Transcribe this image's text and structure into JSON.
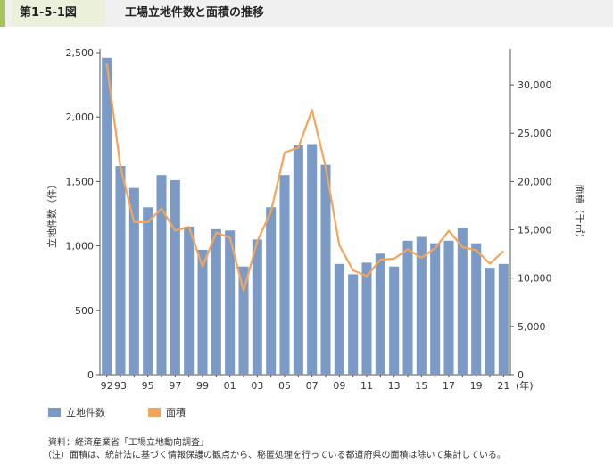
{
  "header": {
    "figure_id": "第1-5-1図",
    "title": "工場立地件数と面積の推移"
  },
  "legend": {
    "bar_label": "立地件数",
    "line_label": "面積"
  },
  "notes": {
    "source": "資料：経済産業省「工場立地動向調査」",
    "note": "（注）面積は、統計法に基づく情報保護の観点から、秘匿処理を行っている都道府県の面積は除いて集計している。"
  },
  "colors": {
    "bar": "#7b9bc6",
    "line": "#f2a55b",
    "accent": "#a6c35a"
  },
  "chart_data": {
    "type": "bar+line",
    "categories": [
      "92",
      "93",
      "94",
      "95",
      "96",
      "97",
      "98",
      "99",
      "00",
      "01",
      "02",
      "03",
      "04",
      "05",
      "06",
      "07",
      "08",
      "09",
      "10",
      "11",
      "12",
      "13",
      "14",
      "15",
      "16",
      "17",
      "18",
      "19",
      "20",
      "21"
    ],
    "x_tick_labels": [
      "92",
      "93",
      "",
      "95",
      "",
      "97",
      "",
      "99",
      "",
      "01",
      "",
      "03",
      "",
      "05",
      "",
      "07",
      "",
      "09",
      "",
      "11",
      "",
      "13",
      "",
      "15",
      "",
      "17",
      "",
      "19",
      "",
      "21"
    ],
    "x_unit": "(年)",
    "series": [
      {
        "name": "立地件数",
        "type": "bar",
        "axis": "left",
        "values": [
          2460,
          1620,
          1450,
          1300,
          1550,
          1510,
          1150,
          970,
          1130,
          1120,
          840,
          1050,
          1300,
          1550,
          1780,
          1790,
          1630,
          860,
          780,
          870,
          940,
          840,
          1040,
          1070,
          1020,
          1040,
          1140,
          1020,
          830,
          860
        ]
      },
      {
        "name": "面積",
        "type": "line",
        "axis": "right",
        "values": [
          32200,
          21500,
          15800,
          15800,
          17200,
          14900,
          15300,
          11200,
          14700,
          14200,
          8700,
          13800,
          16900,
          23000,
          23500,
          27400,
          21500,
          13400,
          10800,
          10200,
          11900,
          12000,
          13000,
          12100,
          13100,
          14900,
          13200,
          12900,
          11500,
          12800
        ]
      }
    ],
    "left_axis": {
      "label": "立地件数（件）",
      "min": 0,
      "max": 2500,
      "ticks": [
        "0",
        "500",
        "1,000",
        "1,500",
        "2,000",
        "2,500"
      ]
    },
    "right_axis": {
      "label": "面積（千㎡）",
      "min": 0,
      "max": 33333,
      "ticks": [
        "0",
        "5,000",
        "10,000",
        "15,000",
        "20,000",
        "25,000",
        "30,000"
      ]
    }
  }
}
